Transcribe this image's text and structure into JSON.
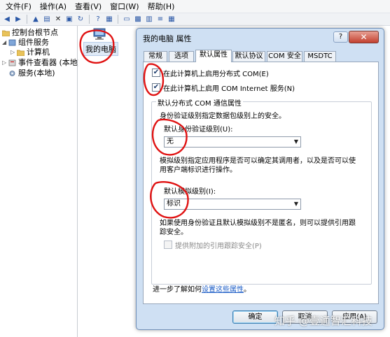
{
  "menu": [
    "文件(F)",
    "操作(A)",
    "查看(V)",
    "窗口(W)",
    "帮助(H)"
  ],
  "tree": {
    "root": "控制台根节点",
    "component_services": "组件服务",
    "computers": "计算机",
    "event_viewer": "事件查看器 (本地)",
    "services": "服务(本地)"
  },
  "content": {
    "my_computer": "我的电脑"
  },
  "dialog": {
    "title": "我的电脑 属性",
    "help": "?",
    "close": "✕",
    "tabs": [
      "常规",
      "选项",
      "默认属性",
      "默认协议",
      "COM 安全",
      "MSDTC"
    ],
    "active_tab": "默认属性",
    "checkbox_dcom": "在此计算机上启用分布式 COM(E)",
    "checkbox_com_internet": "在此计算机上启用 COM Internet 服务(N)",
    "group_title": "默认分布式 COM 通信属性",
    "auth_desc": "身份验证级别指定数据包级别上的安全。",
    "auth_label": "默认身份验证级别(U):",
    "auth_value": "无",
    "impersonation_desc_1": "模拟级别指定应用程序是否可以确定其调用者，以及是否可以使",
    "impersonation_desc_2": "用客户端标识进行操作。",
    "impersonation_label": "默认模拟级别(I):",
    "impersonation_value": "标识",
    "tracking_desc_1": "如果使用身份验证且默认模拟级别不是匿名，则可以提供引用跟",
    "tracking_desc_2": "踪安全。",
    "checkbox_tracking": "提供附加的引用跟踪安全(P)",
    "more_prefix": "进一步了解如何",
    "more_link": "设置这些属性",
    "more_suffix": "。",
    "ok": "确定",
    "cancel": "取消",
    "apply": "应用(A)"
  },
  "watermark": "知乎 @壹通智汇科技"
}
